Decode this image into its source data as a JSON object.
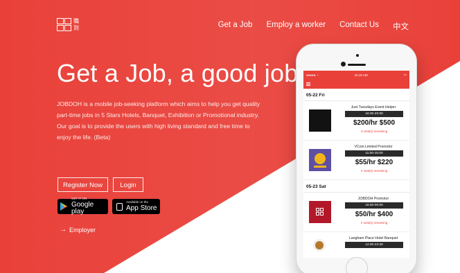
{
  "brand": {
    "logo_chinese": "職到",
    "logo_letters": "JOB DOH"
  },
  "nav": {
    "items": [
      "Get a Job",
      "Employ a worker",
      "Contact Us",
      "中文"
    ]
  },
  "hero": {
    "title": "Get a Job, a good job",
    "description_1": "JOBDOH is a mobile job-seeking platform which aims to help you get quality part-time jobs in 5 Stars Hotels, Banquet, Exhibition or Promotional industry.",
    "description_2": "Our goal is to provide the users with high living standard and free time to enjoy the life. (Beta)"
  },
  "buttons": {
    "register": "Register Now",
    "login": "Login"
  },
  "stores": {
    "google_small": "GET IT ON",
    "google_big": "Google play",
    "apple_small": "Available on the",
    "apple_big": "App Store"
  },
  "employer_link": {
    "label": "Employer"
  },
  "phone": {
    "status_time": "10:15 AM",
    "sections": [
      {
        "date": "05-22 Fri",
        "jobs": [
          {
            "name": "Just Tuesdays Event Helper",
            "time": "18:30-20:00",
            "price": "$200/hr  $500",
            "remaining": "3 seat(s) remaining"
          },
          {
            "name": "VCoin Limited Promotor",
            "time": "11:00-15:00",
            "price": "$55/hr  $220",
            "remaining": "2 seat(s) remaining"
          }
        ]
      },
      {
        "date": "05-23 Sat",
        "jobs": [
          {
            "name": "JOBDOH Promotor",
            "time": "16:00-00:00",
            "price": "$50/hr  $400",
            "remaining": "2 seat(s) remaining"
          },
          {
            "name": "Langham Place Hotel Banquet",
            "time": "12:00-23:30",
            "price": "",
            "remaining": ""
          }
        ]
      }
    ]
  },
  "colors": {
    "brand_red": "#e9413a"
  }
}
